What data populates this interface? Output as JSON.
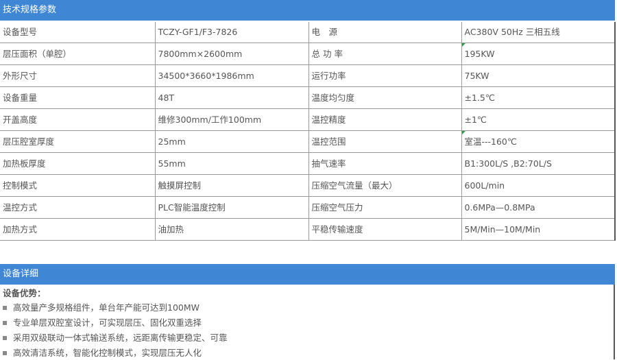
{
  "header1": "技术规格参数",
  "specs": [
    [
      "设备型号",
      "TCZY-GF1/F3-7826",
      "电　源",
      "AC380V 50Hz 三相五线"
    ],
    [
      "层压面积（单腔）",
      "7800mm×2600mm",
      "总 功 率",
      "195KW"
    ],
    [
      "外形尺寸",
      "34500*3660*1986mm",
      "运行功率",
      "75KW"
    ],
    [
      "设备重量",
      "48T",
      "温度均匀度",
      "±1.5℃"
    ],
    [
      "开盖高度",
      "维修300mm/工作100mm",
      "温控精度",
      "±1℃"
    ],
    [
      "层压腔室厚度",
      "25mm",
      "温控范围",
      "室温---160℃"
    ],
    [
      "加热板厚度",
      "55mm",
      "抽气速率",
      "B1:300L/S ,B2:70L/S"
    ],
    [
      "控制模式",
      "触摸屏控制",
      "压缩空气流量（最大）",
      "600L/min"
    ],
    [
      "温控方式",
      "PLC智能温度控制",
      "压缩空气压力",
      "0.6MPa—0.8MPa"
    ],
    [
      "加热方式",
      "油加热",
      "平稳传输速度",
      "5M/Min—10M/Min"
    ]
  ],
  "header2": "设备详细",
  "advantages_title": "设备优势：",
  "advantages": [
    "高效量产多规格组件，单台年产能可达到100MW",
    "专业单层双腔室设计，可实现层压、固化双重选择",
    "采用双级联动一体式输送系统，远距离传输更稳定、可靠",
    "高效清洁系统，智能化控制模式，实现层压无人化"
  ]
}
